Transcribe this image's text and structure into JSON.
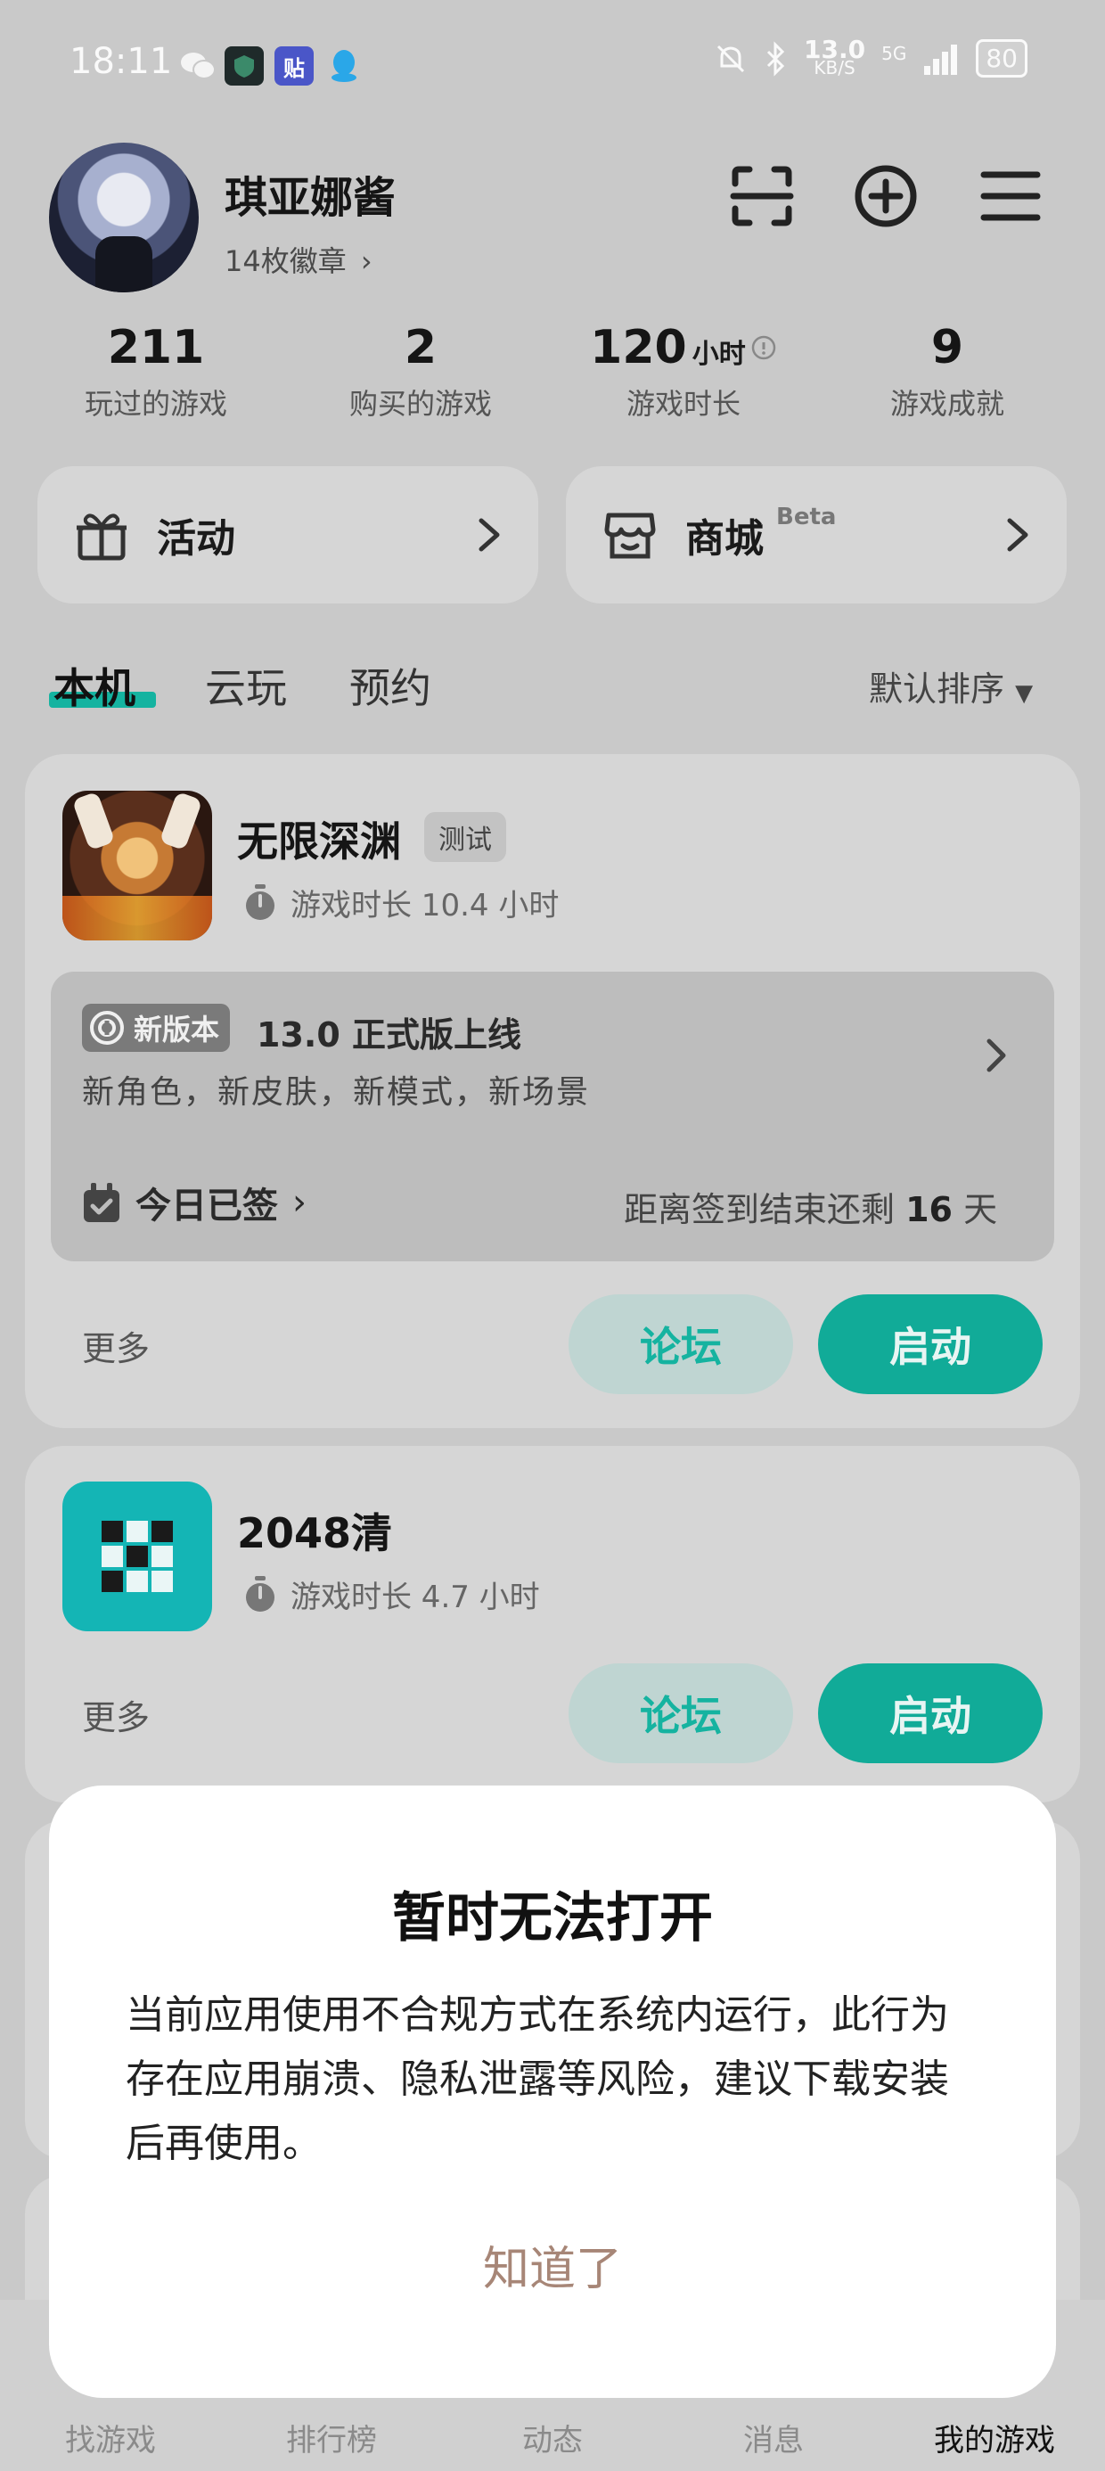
{
  "status_bar": {
    "time": "18:11",
    "net_speed_value": "13.0",
    "net_speed_unit": "KB/S",
    "network": "5G",
    "battery": "80",
    "app_icons": [
      "wechat-icon",
      "shield-app-icon",
      "tieba-icon",
      "qq-icon"
    ]
  },
  "profile": {
    "username": "琪亚娜酱",
    "badges": "14枚徽章"
  },
  "stats": [
    {
      "value": "211",
      "unit": "",
      "label": "玩过的游戏"
    },
    {
      "value": "2",
      "unit": "",
      "label": "购买的游戏"
    },
    {
      "value": "120",
      "unit": "小时",
      "label": "游戏时长"
    },
    {
      "value": "9",
      "unit": "",
      "label": "游戏成就"
    }
  ],
  "actions": {
    "activity_label": "活动",
    "store_label": "商城",
    "store_beta": "Beta"
  },
  "tabs": {
    "local": "本机",
    "cloud": "云玩",
    "reserve": "预约",
    "sort": "默认排序"
  },
  "games": [
    {
      "name": "无限深渊",
      "tag": "测试",
      "playtime": "游戏时长 10.4 小时",
      "news_badge": "新版本",
      "news_title": "13.0 正式版上线",
      "news_subtitle": "新角色，新皮肤，新模式，新场景",
      "signed_label": "今日已签",
      "countdown_prefix": "距离签到结束还剩",
      "countdown_days": "16",
      "countdown_suffix": "天",
      "more": "更多",
      "forum": "论坛",
      "launch": "启动"
    },
    {
      "name": "2048清",
      "playtime": "游戏时长 4.7 小时",
      "more": "更多",
      "forum": "论坛",
      "launch": "启动"
    }
  ],
  "dialog": {
    "title": "暂时无法打开",
    "body": "当前应用使用不合规方式在系统内运行，此行为存在应用崩溃、隐私泄露等风险，建议下载安装后再使用。",
    "button": "知道了"
  },
  "bottom_nav": [
    "找游戏",
    "排行榜",
    "动态",
    "消息",
    "我的游戏"
  ],
  "colors": {
    "accent": "#11ab98",
    "dialog_button": "#a78677",
    "overlay": "#c9c9c9"
  }
}
